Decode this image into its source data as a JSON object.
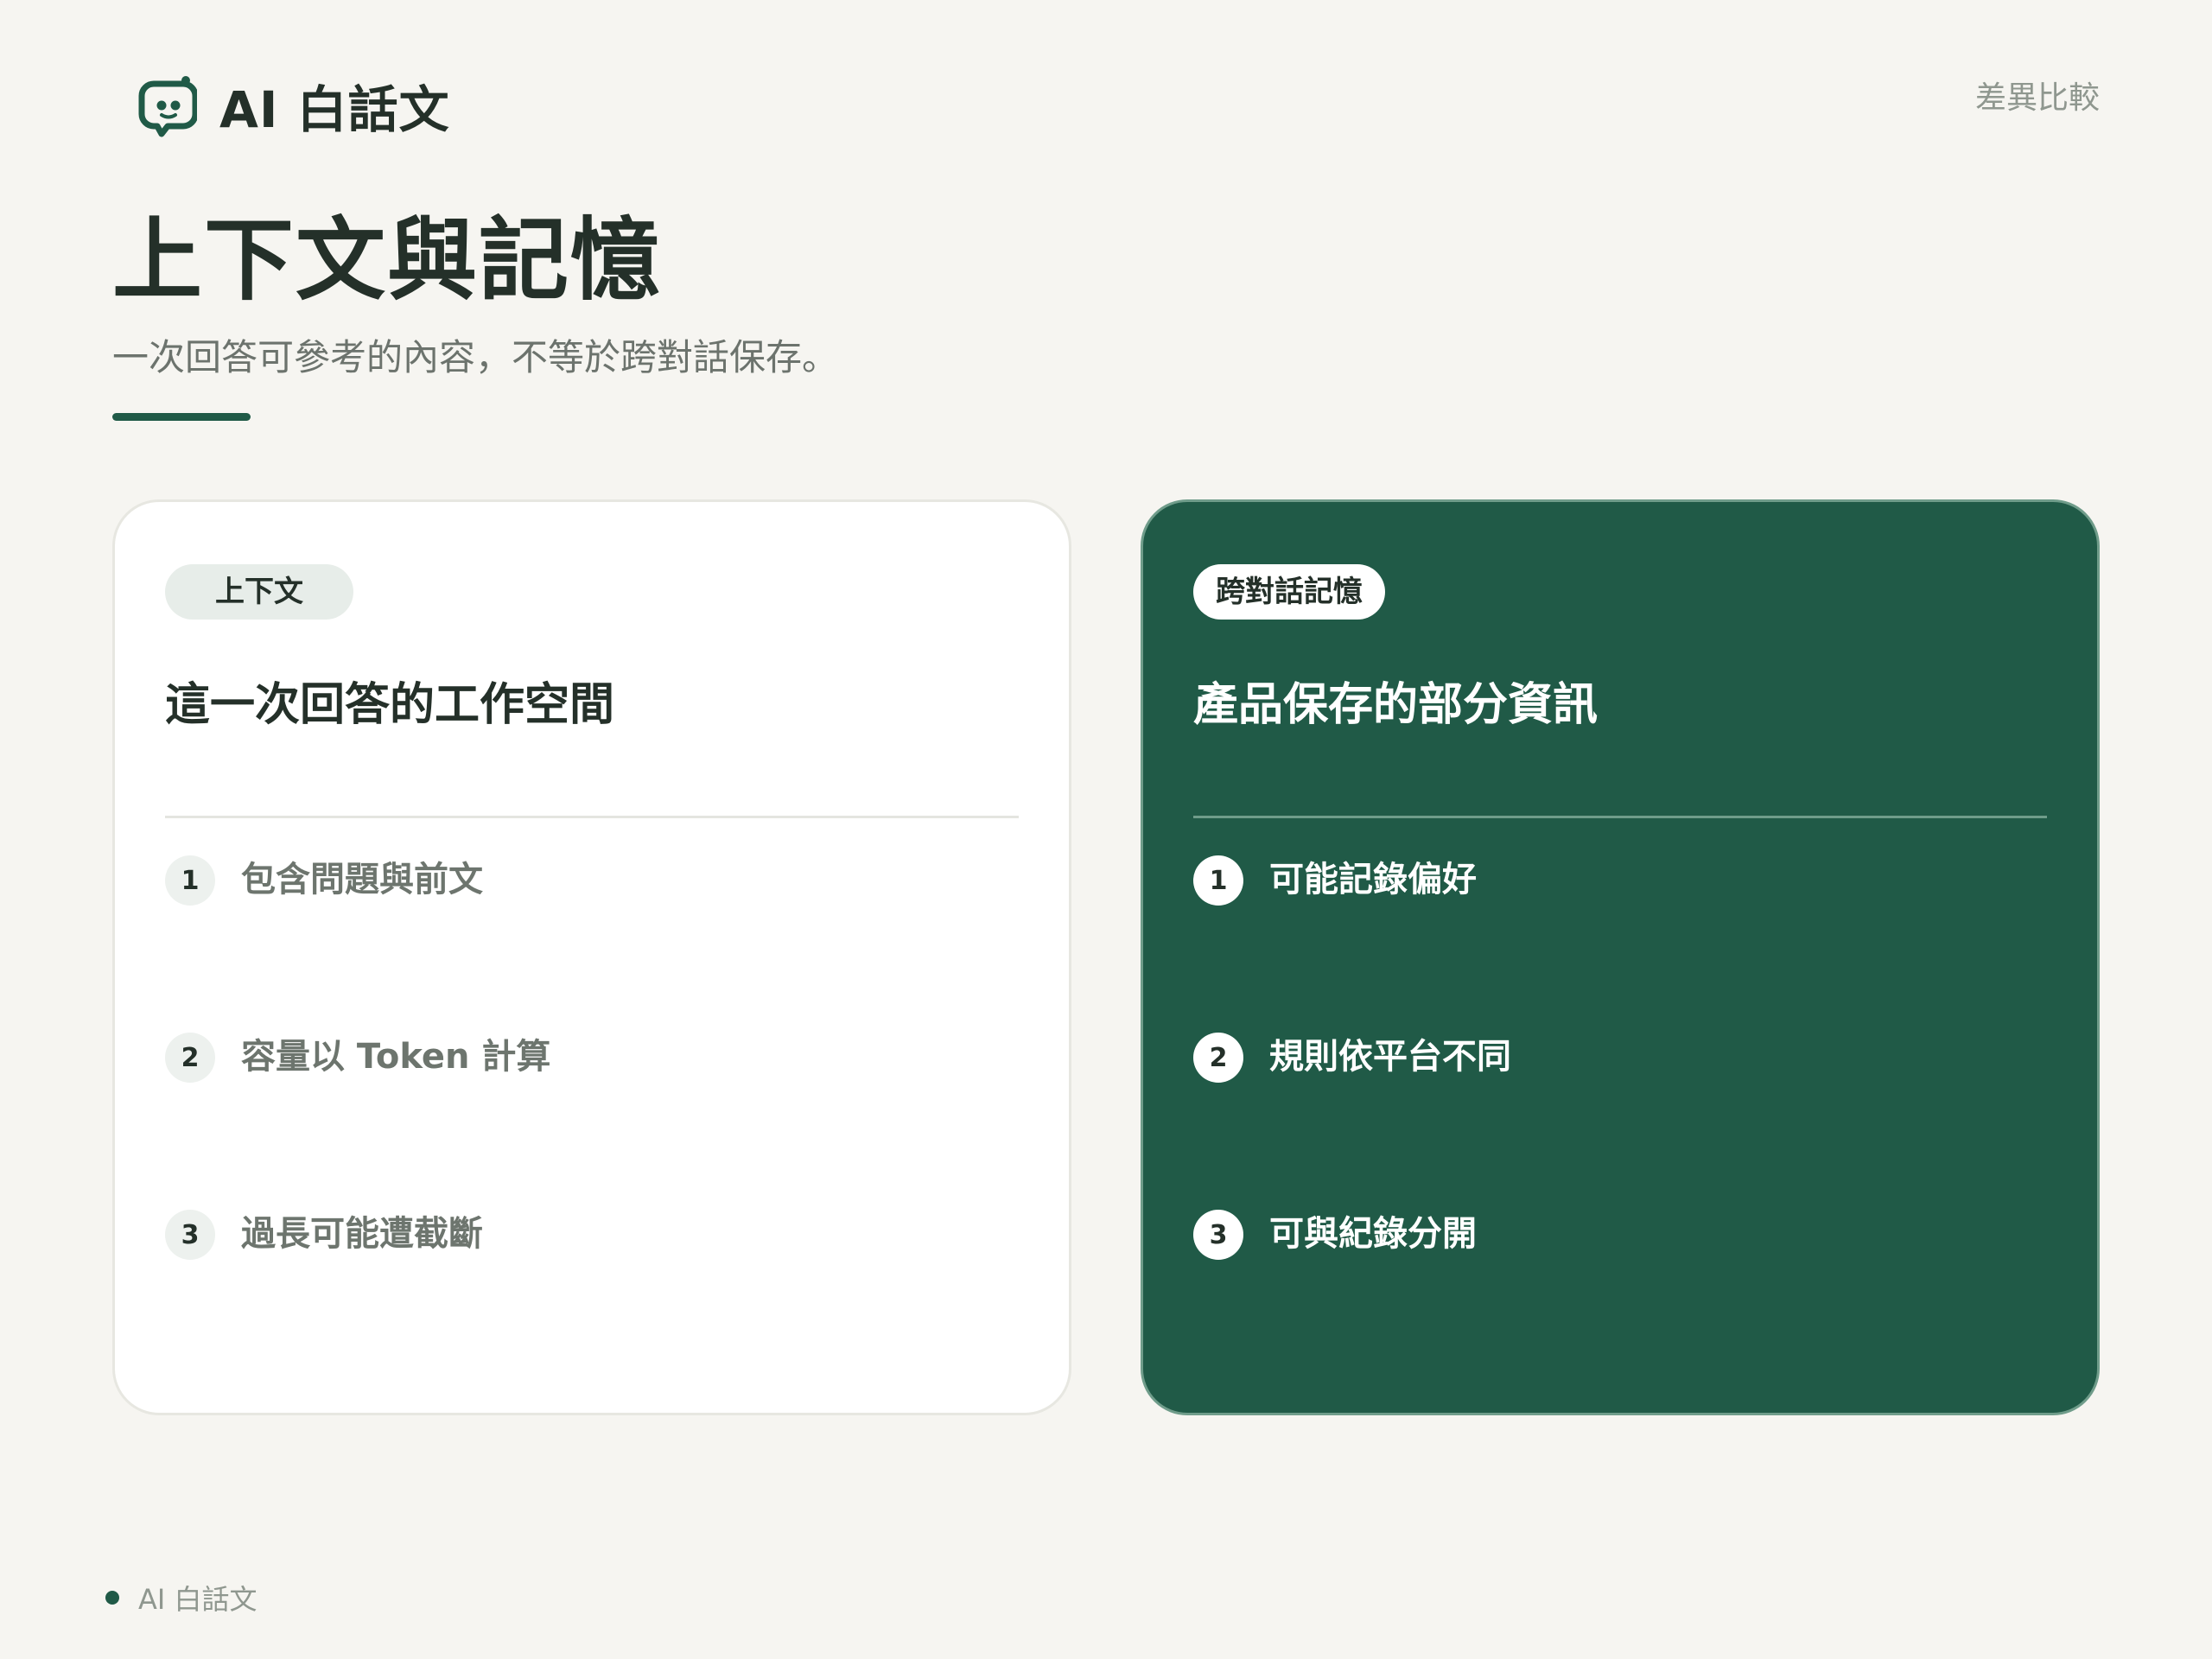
{
  "brand": {
    "icon": "chat-bot-icon",
    "name": "AI 白話文"
  },
  "header": {
    "section_label": "差異比較"
  },
  "page": {
    "title": "上下文與記憶",
    "subtitle": "一次回答可參考的內容，不等於跨對話保存。"
  },
  "cards": [
    {
      "tag": "上下文",
      "heading": "這一次回答的工作空間",
      "items": [
        {
          "number": "1",
          "text": "包含問題與前文"
        },
        {
          "number": "2",
          "text": "容量以 Token 計算"
        },
        {
          "number": "3",
          "text": "過長可能遭截斷"
        }
      ]
    },
    {
      "tag": "跨對話記憶",
      "heading": "產品保存的部分資訊",
      "items": [
        {
          "number": "1",
          "text": "可能記錄偏好"
        },
        {
          "number": "2",
          "text": "規則依平台不同"
        },
        {
          "number": "3",
          "text": "可與紀錄分開"
        }
      ]
    }
  ],
  "footer": {
    "label": "AI 白話文"
  },
  "colors": {
    "accent": "#205a47",
    "background": "#f6f5f1",
    "text": "#243029",
    "muted": "#8f978f"
  }
}
